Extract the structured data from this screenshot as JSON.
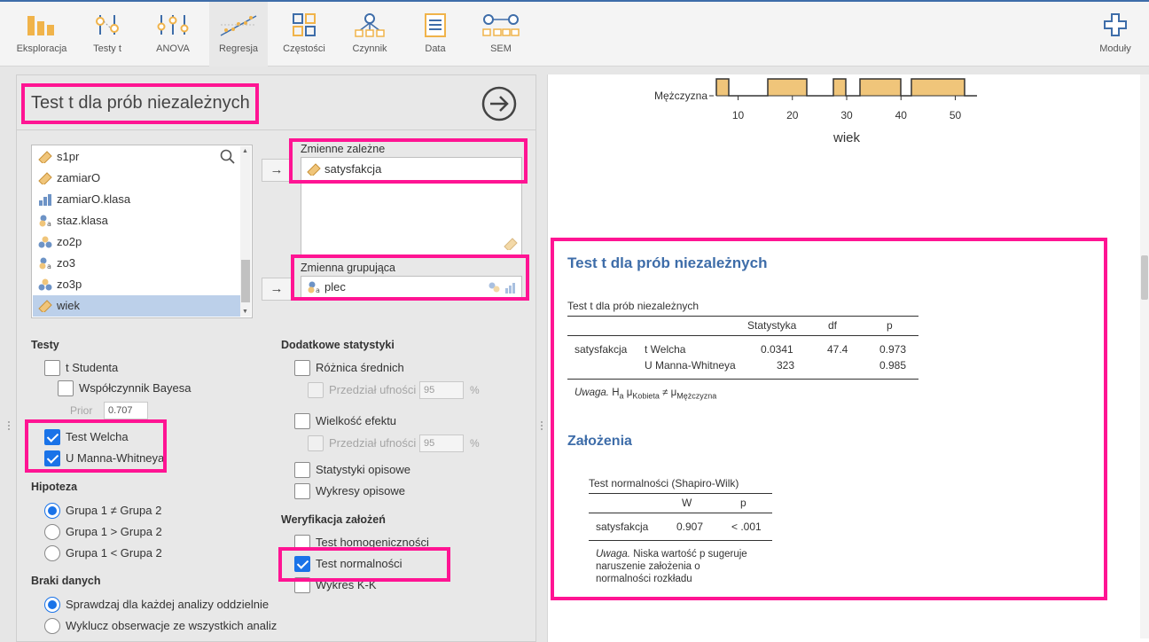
{
  "colors": {
    "accent": "#3e6da9",
    "highlight": "#ff1493",
    "checkbox": "#1a73e8",
    "bar": "#f0c57a",
    "selection": "#bcd0ea"
  },
  "toolbar": {
    "items": [
      {
        "label": "Eksploracja",
        "icon": "bar-chart-icon"
      },
      {
        "label": "Testy t",
        "icon": "t-test-icon"
      },
      {
        "label": "ANOVA",
        "icon": "anova-icon"
      },
      {
        "label": "Regresja",
        "icon": "regression-icon"
      },
      {
        "label": "Częstości",
        "icon": "frequencies-icon"
      },
      {
        "label": "Czynnik",
        "icon": "factor-icon"
      },
      {
        "label": "Data",
        "icon": "data-icon"
      },
      {
        "label": "SEM",
        "icon": "sem-icon"
      }
    ],
    "modules": {
      "label": "Moduły",
      "icon": "plus-icon"
    }
  },
  "panel": {
    "title": "Test t dla prób niezależnych",
    "variables": [
      {
        "name": "s1pr",
        "type": "continuous"
      },
      {
        "name": "zamiarO",
        "type": "continuous"
      },
      {
        "name": "zamiarO.klasa",
        "type": "ordinal"
      },
      {
        "name": "staz.klasa",
        "type": "nominal-text"
      },
      {
        "name": "zo2p",
        "type": "nominal"
      },
      {
        "name": "zo3",
        "type": "nominal-text"
      },
      {
        "name": "zo3p",
        "type": "nominal"
      },
      {
        "name": "wiek",
        "type": "continuous",
        "selected": true
      }
    ],
    "dependent": {
      "label": "Zmienne zależne",
      "items": [
        "satysfakcja"
      ]
    },
    "grouping": {
      "label": "Zmienna grupująca",
      "item": "plec"
    },
    "tests": {
      "heading": "Testy",
      "student": {
        "label": "t Studenta",
        "checked": false
      },
      "bayes": {
        "label": "Współczynnik Bayesa",
        "checked": false
      },
      "prior_label": "Prior",
      "prior_value": "0.707",
      "welch": {
        "label": "Test Welcha",
        "checked": true
      },
      "mann": {
        "label": "U Manna-Whitneya",
        "checked": true
      }
    },
    "hypothesis": {
      "heading": "Hipoteza",
      "options": [
        "Grupa 1 ≠ Grupa 2",
        "Grupa 1 > Grupa 2",
        "Grupa 1 < Grupa 2"
      ],
      "selected": 0
    },
    "missing": {
      "heading": "Braki danych",
      "options": [
        "Sprawdzaj dla każdej analizy oddzielnie",
        "Wyklucz obserwacje ze wszystkich analiz"
      ],
      "selected": 0
    },
    "extra": {
      "heading": "Dodatkowe statystyki",
      "mean_diff": "Różnica średnich",
      "ci_label": "Przedział ufności",
      "ci_value": "95",
      "pct": "%",
      "effect": "Wielkość efektu",
      "ci2_label": "Przedział ufności",
      "ci2_value": "95",
      "pct2": "%",
      "descriptives": "Statystyki opisowe",
      "desc_plots": "Wykresy opisowe"
    },
    "assumptions": {
      "heading": "Weryfikacja założeń",
      "homogeneity": {
        "label": "Test homogeniczności",
        "checked": false
      },
      "normality": {
        "label": "Test normalności",
        "checked": true
      },
      "qq": {
        "label": "Wykres K-K",
        "checked": false
      }
    }
  },
  "chart_data": {
    "type": "bar",
    "category": "Mężczyzna",
    "xlabel": "wiek",
    "xticks": [
      10,
      20,
      30,
      40,
      50
    ],
    "xlim": [
      6,
      54
    ]
  },
  "results": {
    "title": "Test t dla prób niezależnych",
    "table_title": "Test t dla prób niezależnych",
    "headers": [
      "Statystyka",
      "df",
      "p"
    ],
    "row_var": "satysfakcja",
    "rows": [
      {
        "test": "t Welcha",
        "stat": "0.0341",
        "df": "47.4",
        "p": "0.973"
      },
      {
        "test": "U Manna-Whitneya",
        "stat": "323",
        "df": "",
        "p": "0.985"
      }
    ],
    "note_prefix": "Uwaga.",
    "note_h": "H",
    "note_a": "a",
    "note_mu1": "μ",
    "note_g1": "Kobieta",
    "note_ne": "≠",
    "note_mu2": "μ",
    "note_g2": "Mężczyzna",
    "assumptions_title": "Założenia",
    "norm_table_title": "Test normalności (Shapiro-Wilk)",
    "norm_headers": [
      "W",
      "p"
    ],
    "norm_row": {
      "var": "satysfakcja",
      "W": "0.907",
      "p": "< .001"
    },
    "norm_note_prefix": "Uwaga.",
    "norm_note_1": "Niska wartość p sugeruje",
    "norm_note_2": "naruszenie założenia o",
    "norm_note_3": "normalności rozkładu"
  }
}
